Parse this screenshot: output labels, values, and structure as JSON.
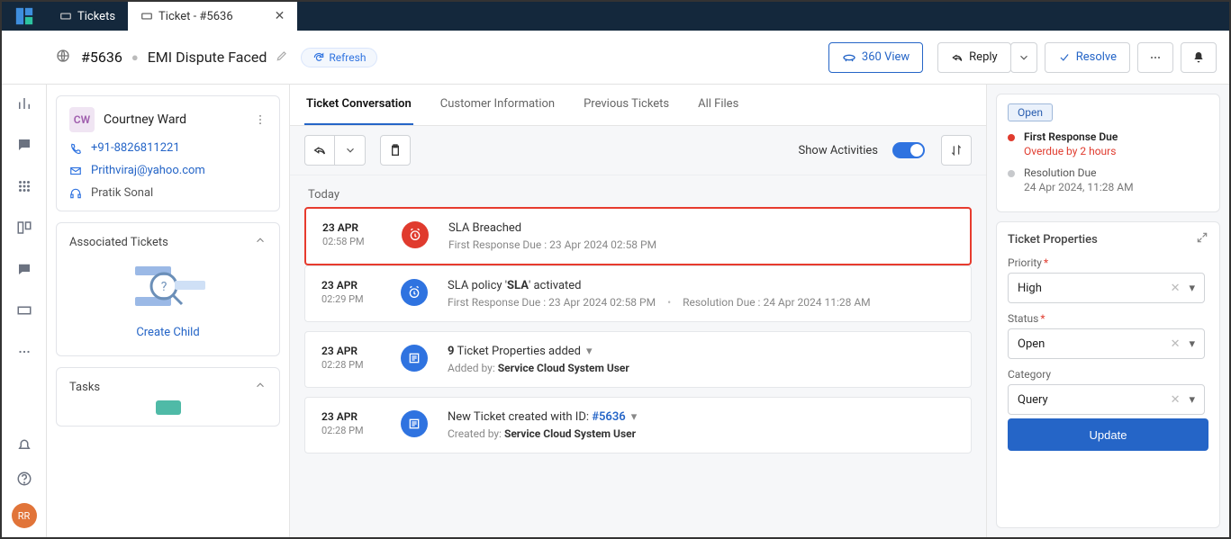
{
  "tabs": {
    "list_label": "Tickets",
    "ticket_tab_label": "Ticket - #5636"
  },
  "header": {
    "ticket_id": "#5636",
    "title": "EMI Dispute Faced",
    "refresh": "Refresh",
    "view360": "360 View",
    "reply": "Reply",
    "resolve": "Resolve"
  },
  "contact": {
    "initials": "CW",
    "name": "Courtney Ward",
    "phone": "+91-8826811221",
    "email": "Prithviraj@yahoo.com",
    "agent": "Pratik Sonal"
  },
  "sidebar": {
    "associated_tickets": "Associated Tickets",
    "create_child": "Create Child",
    "tasks": "Tasks"
  },
  "center_tabs": {
    "conversation": "Ticket Conversation",
    "customer": "Customer Information",
    "previous": "Previous Tickets",
    "files": "All Files"
  },
  "toolbar": {
    "show_activities": "Show Activities"
  },
  "timeline": {
    "today_label": "Today",
    "events": [
      {
        "date": "23 APR",
        "time": "02:58 PM",
        "title": "SLA Breached",
        "sub_label": "First Response Due :",
        "sub_value": "23 Apr 2024 02:58 PM"
      },
      {
        "date": "23 APR",
        "time": "02:29 PM",
        "title_pre": "SLA policy '",
        "title_bold": "SLA",
        "title_post": "' activated",
        "sub1_label": "First Response Due :",
        "sub1_value": "23 Apr 2024 02:58 PM",
        "sub2_label": "Resolution Due :",
        "sub2_value": "24 Apr 2024 11:28 AM"
      },
      {
        "date": "23 APR",
        "time": "02:28 PM",
        "title_pre": "",
        "title_bold": "9",
        "title_post": " Ticket Properties added",
        "sub_label": "Added by:",
        "sub_value": "Service Cloud System User"
      },
      {
        "date": "23 APR",
        "time": "02:28 PM",
        "title_pre": "New Ticket created with ID: ",
        "title_link": "#5636",
        "sub_label": "Created by:",
        "sub_value": "Service Cloud System User"
      }
    ]
  },
  "right": {
    "open_chip": "Open",
    "sla": {
      "first_label": "First Response Due",
      "first_value": "Overdue by 2 hours",
      "res_label": "Resolution Due",
      "res_value": "24 Apr 2024, 11:28 AM"
    },
    "props_title": "Ticket Properties",
    "priority_label": "Priority",
    "priority_value": "High",
    "status_label": "Status",
    "status_value": "Open",
    "category_label": "Category",
    "category_value": "Query",
    "update": "Update"
  },
  "user_avatar": "RR"
}
